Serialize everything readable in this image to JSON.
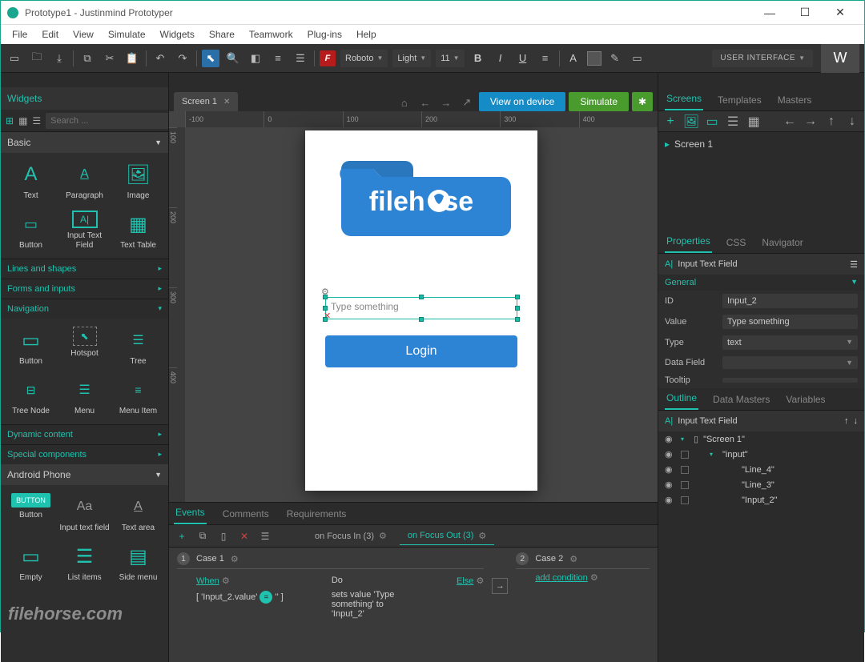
{
  "window": {
    "title": "Prototype1 - Justinmind Prototyper"
  },
  "menu": [
    "File",
    "Edit",
    "View",
    "Simulate",
    "Widgets",
    "Share",
    "Teamwork",
    "Plug-ins",
    "Help"
  ],
  "toolbar": {
    "font_family": "Roboto",
    "font_weight": "Light",
    "font_size": "11",
    "workspace_selector": "USER INTERFACE",
    "workspace_badge": "W"
  },
  "left": {
    "header": "Widgets",
    "search_placeholder": "Search ...",
    "categories": {
      "basic": {
        "label": "Basic",
        "items": [
          "Text",
          "Paragraph",
          "Image",
          "Button",
          "Input Text Field",
          "Text Table"
        ]
      },
      "collapsed": [
        "Lines and shapes",
        "Forms and inputs"
      ],
      "navigation_label": "Navigation",
      "navigation_items": [
        "Button",
        "Hotspot",
        "Tree",
        "Tree Node",
        "Menu",
        "Menu Item"
      ],
      "collapsed2": [
        "Dynamic content",
        "Special components"
      ],
      "phone_label": "Android Phone",
      "phone_items": [
        "Button",
        "Input text field",
        "Text area",
        "Empty",
        "List items",
        "Side menu"
      ]
    }
  },
  "tabs": {
    "screen_tab": "Screen 1",
    "view_on_device": "View on device",
    "simulate": "Simulate"
  },
  "ruler": {
    "h": [
      "-100",
      "0",
      "100",
      "200",
      "300",
      "400"
    ],
    "v": [
      "100",
      "200",
      "300",
      "400"
    ]
  },
  "canvas": {
    "logo_text": "filehorse",
    "input_placeholder": "Type something",
    "login_label": "Login"
  },
  "events": {
    "tabs": [
      "Events",
      "Comments",
      "Requirements"
    ],
    "focus_in": "on Focus In (3)",
    "focus_out": "on Focus Out (3)",
    "case1": "Case 1",
    "case2": "Case 2",
    "when": "When",
    "do": "Do",
    "else": "Else",
    "add_condition": "add condition",
    "condition_expr": "[ 'Input_2.value'      '' ]",
    "action_text": "sets value 'Type something' to 'Input_2'"
  },
  "right": {
    "top_tabs": [
      "Screens",
      "Templates",
      "Masters"
    ],
    "screen_item": "Screen 1",
    "prop_tabs": [
      "Properties",
      "CSS",
      "Navigator"
    ],
    "selected_widget": "Input Text Field",
    "section": "General",
    "props": {
      "id_label": "ID",
      "id_value": "Input_2",
      "value_label": "Value",
      "value_value": "Type something",
      "type_label": "Type",
      "type_value": "text",
      "datafield_label": "Data Field",
      "datafield_value": "",
      "tooltip_label": "Tooltip"
    },
    "outline_tabs": [
      "Outline",
      "Data Masters",
      "Variables"
    ],
    "outline": {
      "header": "Input Text Field",
      "items": [
        "\"Screen 1\"",
        "\"input\"",
        "\"Line_4\"",
        "\"Line_3\"",
        "\"Input_2\""
      ]
    }
  },
  "watermark": "filehorse.com"
}
